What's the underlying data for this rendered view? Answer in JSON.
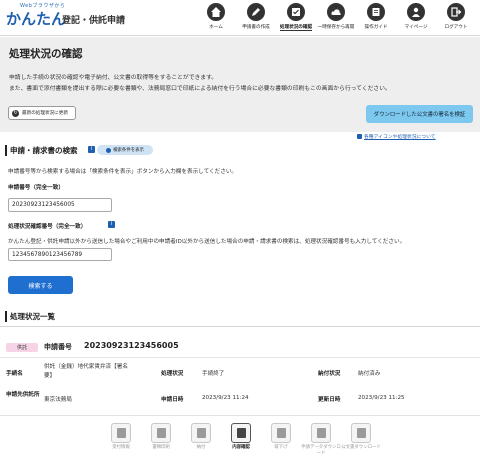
{
  "header": {
    "logo_small": "Webブラウザから",
    "logo_kana": "かんたん",
    "logo_rest": "登記・供託申請",
    "nav": [
      {
        "label": "ホーム",
        "icon": "home-icon",
        "active": false
      },
      {
        "label": "申請書の作成",
        "icon": "pencil-icon",
        "active": false
      },
      {
        "label": "処理状況の確認",
        "icon": "list-check-icon",
        "active": true
      },
      {
        "label": "一時保存から再開",
        "icon": "cloud-icon",
        "active": false
      },
      {
        "label": "操作ガイド",
        "icon": "book-icon",
        "active": false
      },
      {
        "label": "マイページ",
        "icon": "user-icon",
        "active": false
      },
      {
        "label": "ログアウト",
        "icon": "logout-icon",
        "active": false
      }
    ]
  },
  "page": {
    "title": "処理状況の確認",
    "intro_line1": "申請した手続の状況の確認や電子納付、公文書の取得等をすることができます。",
    "intro_line2": "また、書面で添付書類を提出する際に必要な書類や、法務局窓口で印紙による納付を行う場合に必要な書類の印刷もこの画面から行ってください。",
    "refresh_button": "最新の処理状況に更新",
    "verify_button": "ダウンロードした公文書の署名を検証",
    "legend_link": "各種アイコンや処理状況について"
  },
  "search": {
    "section_title": "申請・請求書の検索",
    "show_conditions_button": "検索条件を表示",
    "hint": "申請番号等から検索する場合は「検索条件を表示」ボタンから入力欄を表示してください。",
    "appno_label": "申請番号（完全一致）",
    "appno_value": "20230923123456005",
    "confirm_label": "処理状況確認番号（完全一致）",
    "confirm_note": "かんたん登記・供託申請以外から送信した場合やご利用中の申請者ID以外から送信した場合の申請・請求書の検索は、処理状況確認番号も入力してください。",
    "confirm_value": "1234567890123456789",
    "search_button": "検索する"
  },
  "results": {
    "section_title": "処理状況一覧",
    "items": [
      {
        "type_badge": "供託",
        "appno_label": "申請番号",
        "appno": "20230923123456005",
        "procedure_label": "手続名",
        "procedure": "供託（金銭）地代家賃弁済【署名要】",
        "status_label": "処理状況",
        "status": "手続終了",
        "payment_label": "納付状況",
        "payment": "納付済み",
        "office_label": "申請先供託所",
        "office": "東京法務局",
        "applied_label": "申請日時",
        "applied": "2023/9/23 11:24",
        "updated_label": "更新日時",
        "updated": "2023/9/23 11:25"
      }
    ]
  },
  "bottom_nav": [
    {
      "label": "受付情報",
      "icon": "receipt-icon",
      "active": false
    },
    {
      "label": "書類印刷",
      "icon": "print-icon",
      "active": false
    },
    {
      "label": "納付",
      "icon": "payment-icon",
      "active": false
    },
    {
      "label": "内容確認",
      "icon": "document-icon",
      "active": true
    },
    {
      "label": "取下げ",
      "icon": "withdraw-icon",
      "active": false
    },
    {
      "label": "申請データダウンロード",
      "icon": "download-data-icon",
      "active": false
    },
    {
      "label": "公文書ダウンロード",
      "icon": "download-doc-icon",
      "active": false
    }
  ]
}
